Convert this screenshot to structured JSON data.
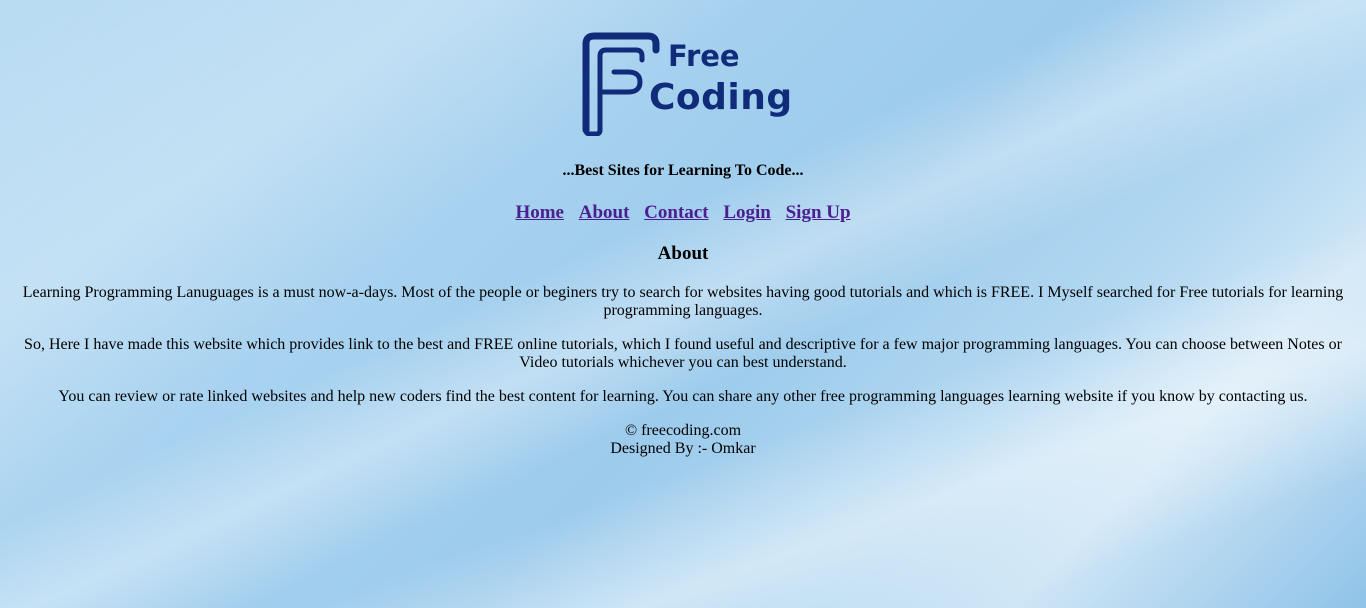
{
  "logo": {
    "line1": "Free",
    "line2": "Coding",
    "brand_color": "#0f2b7a"
  },
  "tagline": "...Best Sites for Learning To Code...",
  "nav": {
    "items": [
      {
        "label": "Home"
      },
      {
        "label": "About"
      },
      {
        "label": "Contact"
      },
      {
        "label": "Login"
      },
      {
        "label": "Sign Up"
      }
    ],
    "link_color": "#4b1f8f"
  },
  "section": {
    "title": "About",
    "paragraphs": [
      "Learning Programming Lanuguages is a must now-a-days. Most of the people or beginers try to search for websites having good tutorials and which is FREE. I Myself searched for Free tutorials for learning programming languages.",
      "So, Here I have made this website which provides link to the best and FREE online tutorials, which I found useful and descriptive for a few major programming languages. You can choose between Notes or Video tutorials whichever you can best understand.",
      "You can review or rate linked websites and help new coders find the best content for learning. You can share any other free programming languages learning website if you know by contacting us."
    ]
  },
  "footer": {
    "copyright": "© freecoding.com",
    "designer": "Designed By :- Omkar"
  }
}
